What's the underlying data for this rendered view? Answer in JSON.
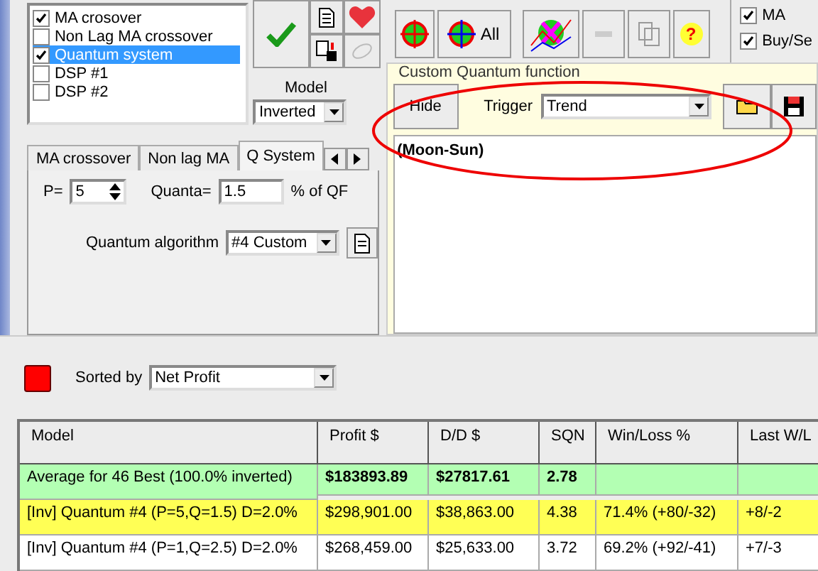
{
  "strategies": {
    "items": [
      {
        "label": "MA crosover",
        "checked": true,
        "selected": false
      },
      {
        "label": "Non Lag MA crossover",
        "checked": false,
        "selected": false
      },
      {
        "label": "Quantum system",
        "checked": true,
        "selected": true
      },
      {
        "label": "DSP #1",
        "checked": false,
        "selected": false
      },
      {
        "label": "DSP #2",
        "checked": false,
        "selected": false
      }
    ]
  },
  "model": {
    "label": "Model",
    "value": "Inverted"
  },
  "tabs": [
    {
      "label": "MA crossover",
      "selected": false
    },
    {
      "label": "Non lag MA",
      "selected": false
    },
    {
      "label": "Q System",
      "selected": true
    }
  ],
  "q_system": {
    "p_label": "P=",
    "p_value": "5",
    "quanta_label": "Quanta=",
    "quanta_value": "1.5",
    "quanta_unit": "% of QF",
    "algorithm_label": "Quantum algorithm",
    "algorithm_value": "#4 Custom"
  },
  "optimization": {
    "all_label": "All",
    "help_label": "?"
  },
  "view": {
    "items": [
      {
        "label": "MA",
        "checked": true
      },
      {
        "label": "Buy/Se",
        "checked": true
      }
    ]
  },
  "custom_function": {
    "title": "Custom Quantum function",
    "hide_button": "Hide",
    "trigger_label": "Trigger",
    "trigger_value": "Trend",
    "formula": "(Moon-Sun)"
  },
  "sort": {
    "label": "Sorted by",
    "value": "Net Profit"
  },
  "table": {
    "columns": [
      "Model",
      "Profit $",
      "D/D $",
      "SQN",
      "Win/Loss %",
      "Last W/L"
    ],
    "rows": [
      {
        "kind": "average",
        "selected": false,
        "cells": [
          "Average for 46 Best (100.0% inverted)",
          "$183893.89",
          "$27817.61",
          "2.78",
          "",
          ""
        ]
      },
      {
        "kind": "result",
        "selected": true,
        "cells": [
          "[Inv] Quantum #4 (P=5,Q=1.5) D=2.0%",
          "$298,901.00",
          "$38,863.00",
          "4.38",
          "71.4% (+80/-32)",
          "+8/-2"
        ]
      },
      {
        "kind": "result",
        "selected": false,
        "cells": [
          "[Inv] Quantum #4 (P=1,Q=2.5) D=2.0%",
          "$268,459.00",
          "$25,633.00",
          "3.72",
          "69.2% (+92/-41)",
          "+7/-3"
        ]
      }
    ]
  }
}
